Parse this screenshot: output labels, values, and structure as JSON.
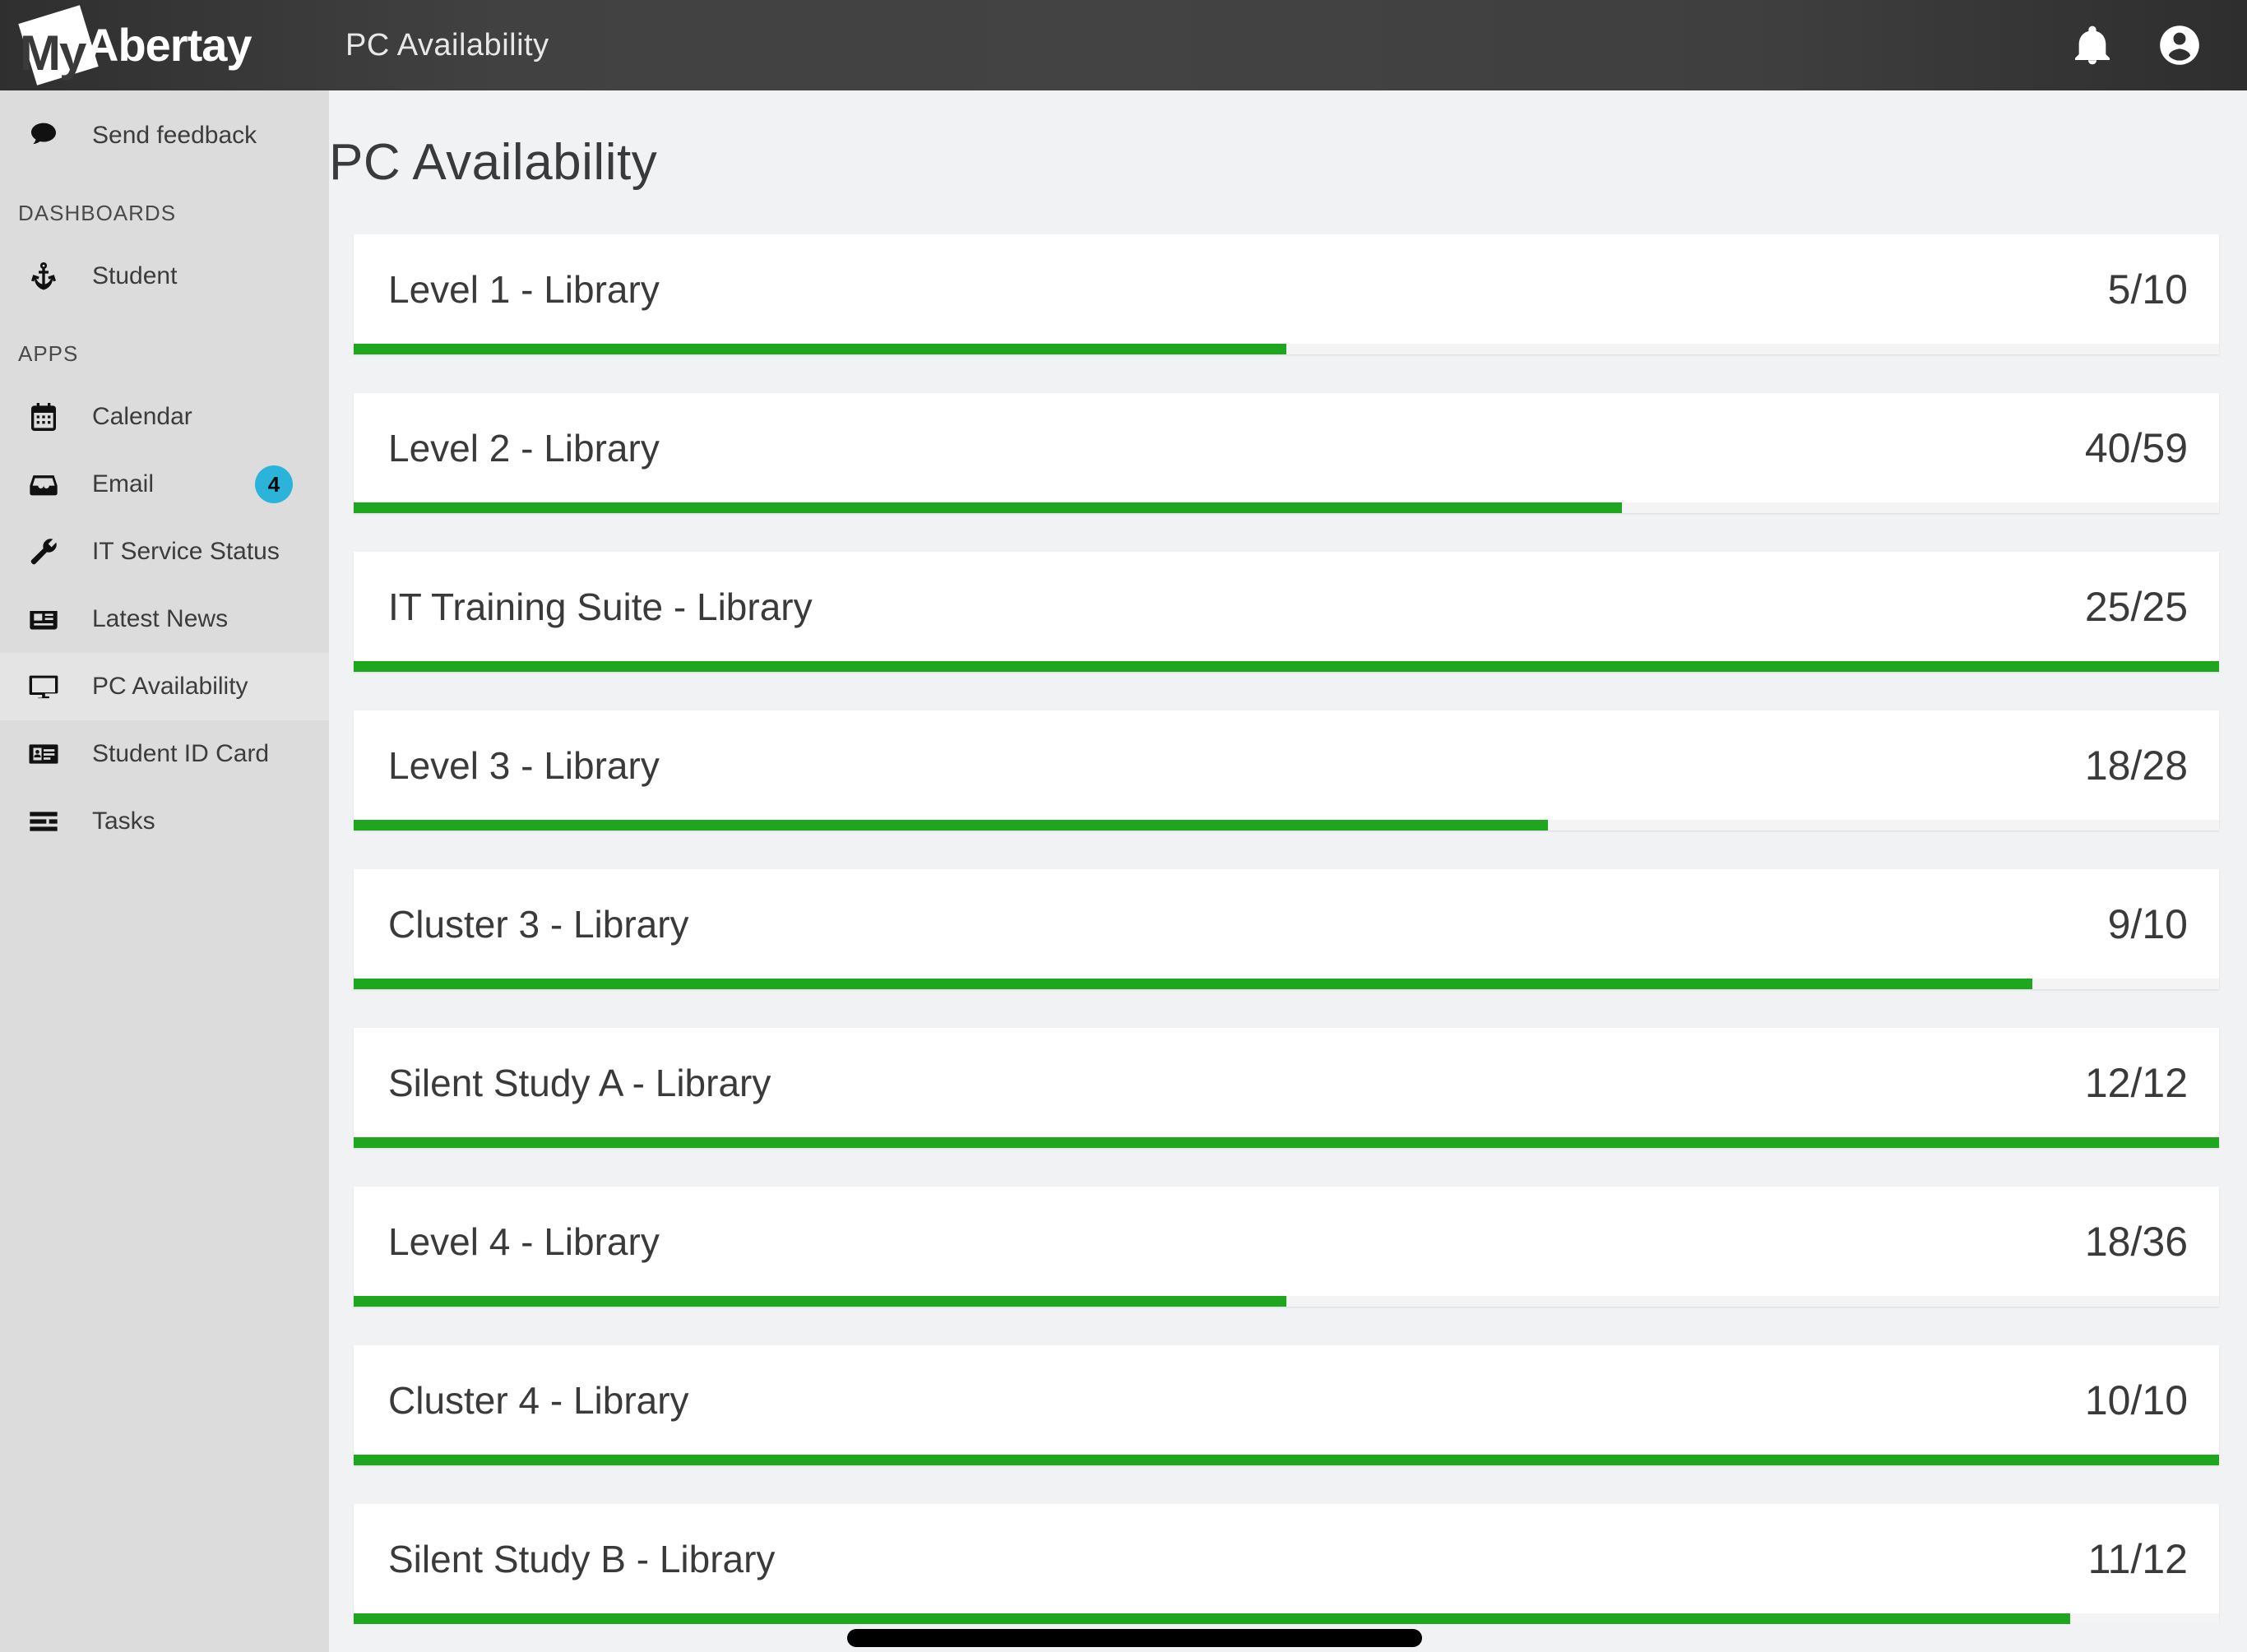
{
  "header": {
    "brand_prefix": "My",
    "brand_name": "Abertay",
    "title": "PC Availability",
    "notifications_icon": "bell-icon",
    "account_icon": "user-account-icon"
  },
  "sidebar": {
    "feedback": {
      "label": "Send feedback",
      "icon": "speech-bubble-icon"
    },
    "sections": [
      {
        "heading": "DASHBOARDS",
        "items": [
          {
            "label": "Student",
            "icon": "anchor-icon",
            "active": false,
            "badge": ""
          }
        ]
      },
      {
        "heading": "APPS",
        "items": [
          {
            "label": "Calendar",
            "icon": "calendar-icon",
            "active": false,
            "badge": ""
          },
          {
            "label": "Email",
            "icon": "inbox-icon",
            "active": false,
            "badge": "4"
          },
          {
            "label": "IT Service Status",
            "icon": "wrench-icon",
            "active": false,
            "badge": ""
          },
          {
            "label": "Latest News",
            "icon": "newspaper-icon",
            "active": false,
            "badge": ""
          },
          {
            "label": "PC Availability",
            "icon": "monitor-icon",
            "active": true,
            "badge": ""
          },
          {
            "label": "Student ID Card",
            "icon": "id-card-icon",
            "active": false,
            "badge": ""
          },
          {
            "label": "Tasks",
            "icon": "task-list-icon",
            "active": false,
            "badge": ""
          }
        ]
      }
    ]
  },
  "main": {
    "page_title": "PC Availability",
    "rows": [
      {
        "name": "Level 1 - Library",
        "count": "5/10",
        "available": 5,
        "total": 10,
        "percent": 50
      },
      {
        "name": "Level 2 - Library",
        "count": "40/59",
        "available": 40,
        "total": 59,
        "percent": 68
      },
      {
        "name": "IT Training Suite - Library",
        "count": "25/25",
        "available": 25,
        "total": 25,
        "percent": 100
      },
      {
        "name": "Level 3 - Library",
        "count": "18/28",
        "available": 18,
        "total": 28,
        "percent": 64
      },
      {
        "name": "Cluster 3 - Library",
        "count": "9/10",
        "available": 9,
        "total": 10,
        "percent": 90
      },
      {
        "name": "Silent Study A - Library",
        "count": "12/12",
        "available": 12,
        "total": 12,
        "percent": 100
      },
      {
        "name": "Level 4 - Library",
        "count": "18/36",
        "available": 18,
        "total": 36,
        "percent": 50
      },
      {
        "name": "Cluster 4 - Library",
        "count": "10/10",
        "available": 10,
        "total": 10,
        "percent": 100
      },
      {
        "name": "Silent Study B - Library",
        "count": "11/12",
        "available": 11,
        "total": 12,
        "percent": 92
      }
    ]
  },
  "colors": {
    "bar_green": "#1ea61e",
    "badge_blue": "#2bb3d9",
    "header_dark": "#3f3f3f",
    "sidebar_grey": "#dcdcdc",
    "page_bg": "#f1f2f4"
  },
  "scrollbar": {
    "thumb_left_pct": 27,
    "thumb_width_pct": 30
  }
}
